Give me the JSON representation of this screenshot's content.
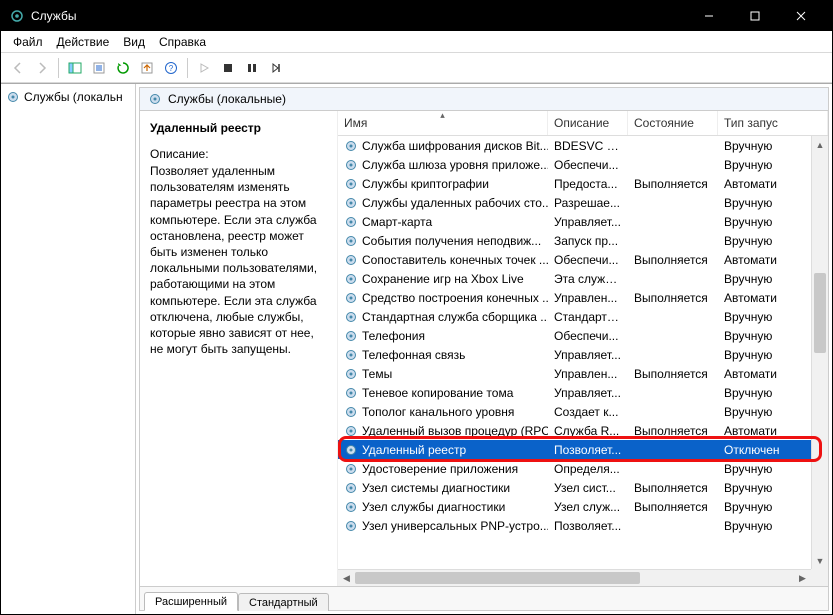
{
  "window": {
    "title": "Службы"
  },
  "menu": {
    "file": "Файл",
    "action": "Действие",
    "view": "Вид",
    "help": "Справка"
  },
  "tree": {
    "root": "Службы (локальн"
  },
  "pane": {
    "header": "Службы (локальные)"
  },
  "detail": {
    "selected_name": "Удаленный реестр",
    "desc_label": "Описание:",
    "desc_text": "Позволяет удаленным пользователям изменять параметры реестра на этом компьютере. Если эта служба остановлена, реестр может быть изменен только локальными пользователями, работающими на этом компьютере. Если эта служба отключена, любые службы, которые явно зависят от нее, не могут быть запущены."
  },
  "columns": {
    "name": "Имя",
    "desc": "Описание",
    "state": "Состояние",
    "start": "Тип запус"
  },
  "rows": [
    {
      "name": "Служба шифрования дисков Bit...",
      "desc": "BDESVC пр...",
      "state": "",
      "start": "Вручную"
    },
    {
      "name": "Служба шлюза уровня приложе...",
      "desc": "Обеспечи...",
      "state": "",
      "start": "Вручную"
    },
    {
      "name": "Службы криптографии",
      "desc": "Предоста...",
      "state": "Выполняется",
      "start": "Автомати"
    },
    {
      "name": "Службы удаленных рабочих сто...",
      "desc": "Разрешае...",
      "state": "",
      "start": "Вручную"
    },
    {
      "name": "Смарт-карта",
      "desc": "Управляет...",
      "state": "",
      "start": "Вручную"
    },
    {
      "name": "События получения неподвиж...",
      "desc": "Запуск пр...",
      "state": "",
      "start": "Вручную"
    },
    {
      "name": "Сопоставитель конечных точек ...",
      "desc": "Обеспечи...",
      "state": "Выполняется",
      "start": "Автомати"
    },
    {
      "name": "Сохранение игр на Xbox Live",
      "desc": "Эта служб...",
      "state": "",
      "start": "Вручную"
    },
    {
      "name": "Средство построения конечных ...",
      "desc": "Управлен...",
      "state": "Выполняется",
      "start": "Автомати"
    },
    {
      "name": "Стандартная служба сборщика ...",
      "desc": "Стандартн...",
      "state": "",
      "start": "Вручную"
    },
    {
      "name": "Телефония",
      "desc": "Обеспечи...",
      "state": "",
      "start": "Вручную"
    },
    {
      "name": "Телефонная связь",
      "desc": "Управляет...",
      "state": "",
      "start": "Вручную"
    },
    {
      "name": "Темы",
      "desc": "Управлен...",
      "state": "Выполняется",
      "start": "Автомати"
    },
    {
      "name": "Теневое копирование тома",
      "desc": "Управляет...",
      "state": "",
      "start": "Вручную"
    },
    {
      "name": "Тополог канального уровня",
      "desc": "Создает к...",
      "state": "",
      "start": "Вручную"
    },
    {
      "name": "Удаленный вызов процедур (RPC)",
      "desc": "Служба R...",
      "state": "Выполняется",
      "start": "Автомати"
    },
    {
      "name": "Удаленный реестр",
      "desc": "Позволяет...",
      "state": "",
      "start": "Отключен",
      "selected": true
    },
    {
      "name": "Удостоверение приложения",
      "desc": "Определя...",
      "state": "",
      "start": "Вручную"
    },
    {
      "name": "Узел системы диагностики",
      "desc": "Узел сист...",
      "state": "Выполняется",
      "start": "Вручную"
    },
    {
      "name": "Узел службы диагностики",
      "desc": "Узел служ...",
      "state": "Выполняется",
      "start": "Вручную"
    },
    {
      "name": "Узел универсальных PNP-устро...",
      "desc": "Позволяет...",
      "state": "",
      "start": "Вручную"
    }
  ],
  "tabs": {
    "ext": "Расширенный",
    "std": "Стандартный"
  }
}
